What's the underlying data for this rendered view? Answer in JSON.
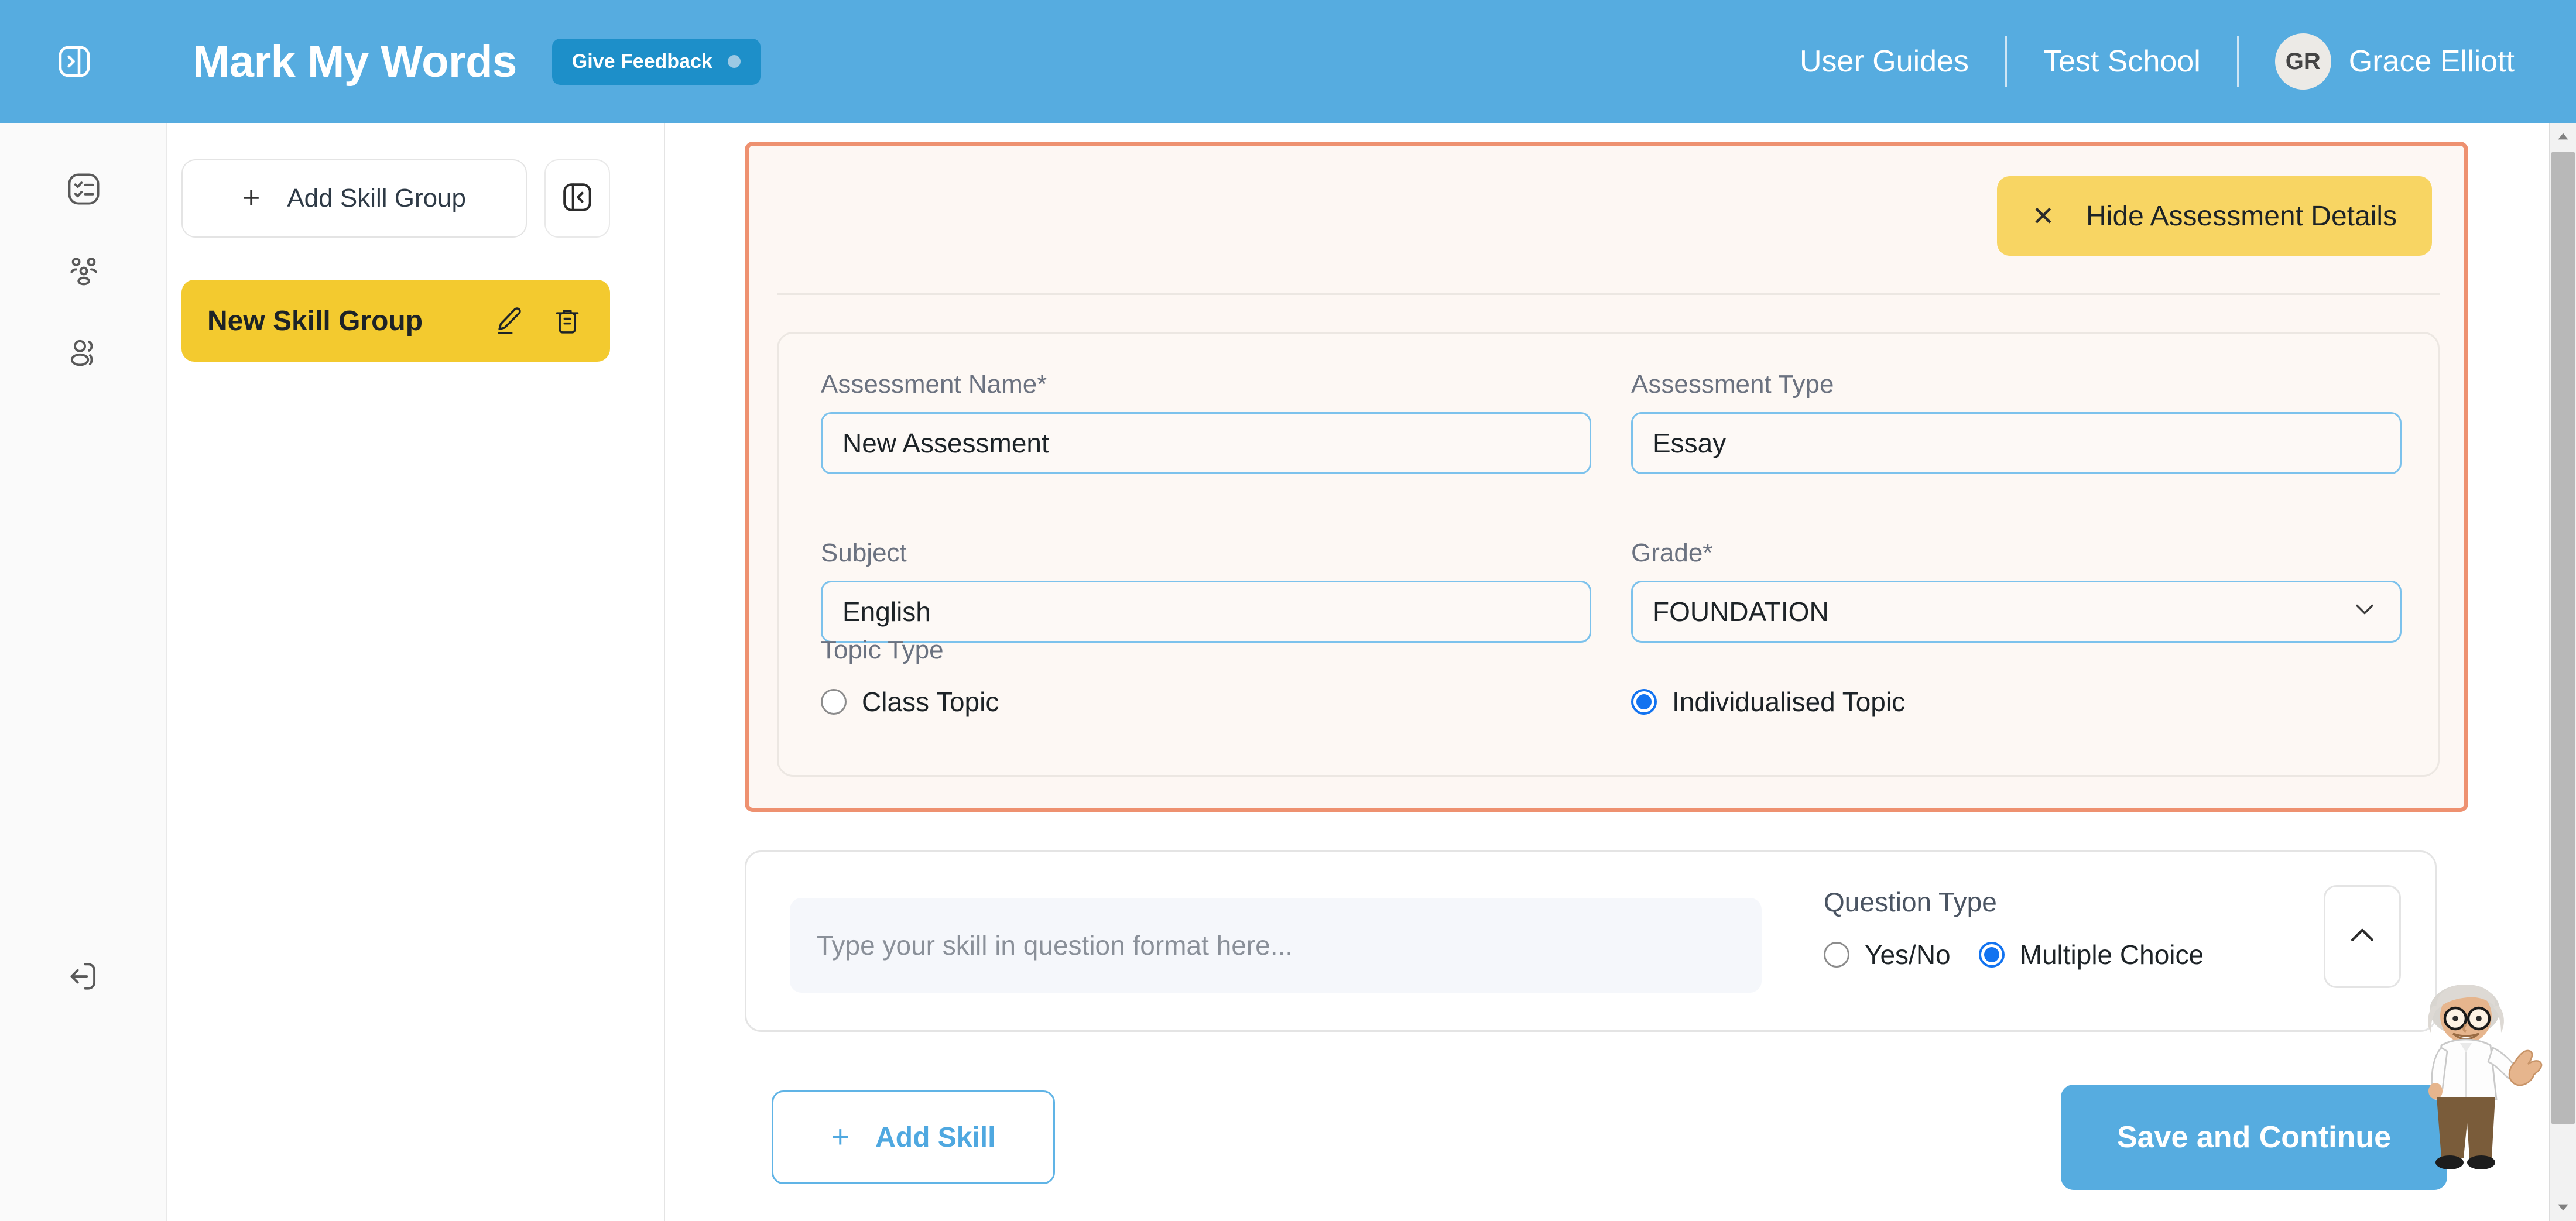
{
  "header": {
    "menu_toggle_icon": "panel-toggle-icon",
    "brand": "Mark My Words",
    "feedback_label": "Give Feedback",
    "user_guides": "User Guides",
    "school": "Test School",
    "avatar_initials": "GR",
    "user_name": "Grace Elliott",
    "bg_color": "#56ace0",
    "feedback_bg": "#1d8fc9"
  },
  "rail": {
    "items": [
      {
        "name": "assessments",
        "icon": "checklist-icon"
      },
      {
        "name": "groups",
        "icon": "people-group-icon"
      },
      {
        "name": "students",
        "icon": "users-icon"
      }
    ],
    "logout": {
      "name": "logout",
      "icon": "logout-icon"
    }
  },
  "skill_groups": {
    "add_button_label": "Add Skill Group",
    "collapse_icon": "panel-collapse-left-icon",
    "items": [
      {
        "label": "New Skill Group",
        "selected": true,
        "edit_icon": "pencil-icon",
        "delete_icon": "trash-icon",
        "bg_color": "#f3ca2f"
      }
    ]
  },
  "assessment_panel": {
    "border_color": "#ee9170",
    "hide_button_label": "Hide Assessment Details",
    "hide_button_icon": "close-x-icon",
    "hide_button_bg": "#f8d563",
    "fields": {
      "assessment_name": {
        "label": "Assessment Name*",
        "value": "New Assessment"
      },
      "assessment_type": {
        "label": "Assessment Type",
        "value": "Essay"
      },
      "subject": {
        "label": "Subject",
        "value": "English"
      },
      "grade": {
        "label": "Grade*",
        "value": "FOUNDATION",
        "chevron_icon": "chevron-down-icon"
      }
    },
    "topic_type": {
      "label": "Topic Type",
      "options": [
        {
          "label": "Class Topic",
          "selected": false
        },
        {
          "label": "Individualised Topic",
          "selected": true
        }
      ]
    }
  },
  "skill_card": {
    "skill_placeholder": "Type your skill in question format here...",
    "question_type_label": "Question Type",
    "question_type_options": [
      {
        "label": "Yes/No",
        "selected": false
      },
      {
        "label": "Multiple Choice",
        "selected": true
      }
    ],
    "collapse_icon": "chevron-up-icon"
  },
  "footer": {
    "add_skill_label": "Add Skill",
    "save_label": "Save and Continue",
    "save_bg": "#56ace0"
  },
  "mascot": {
    "name": "professor-mascot"
  },
  "scrollbar": {
    "up_icon": "scroll-up-arrow-icon",
    "down_icon": "scroll-down-arrow-icon"
  }
}
